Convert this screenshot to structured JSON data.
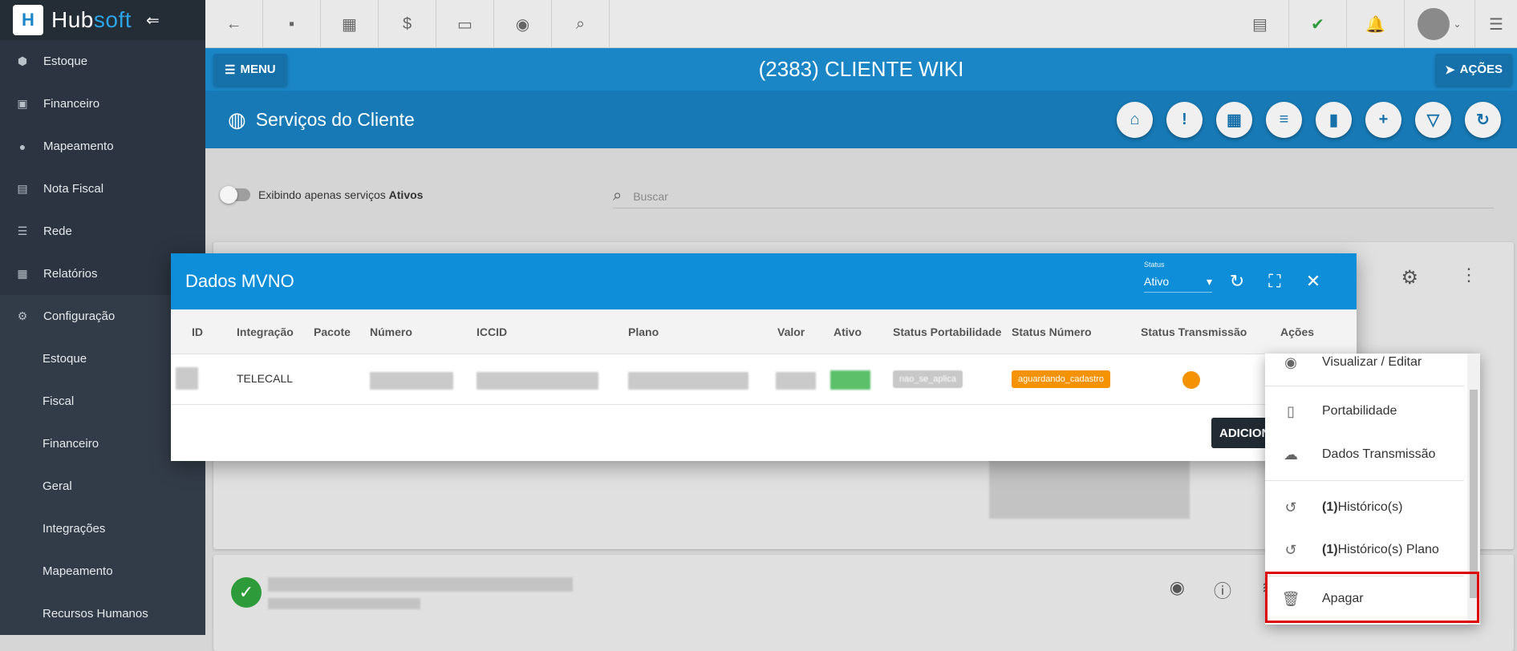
{
  "app": {
    "brand_left": "Hub",
    "brand_right": "soft"
  },
  "sidebar": {
    "items": [
      {
        "label": "Estoque",
        "icon": "cube-icon"
      },
      {
        "label": "Financeiro",
        "icon": "money-icon"
      },
      {
        "label": "Mapeamento",
        "icon": "map-pin-icon"
      },
      {
        "label": "Nota Fiscal",
        "icon": "document-icon"
      },
      {
        "label": "Rede",
        "icon": "server-icon"
      },
      {
        "label": "Relatórios",
        "icon": "report-icon"
      },
      {
        "label": "Configuração",
        "icon": "gear-icon"
      }
    ],
    "sub_items": [
      "Estoque",
      "Fiscal",
      "Financeiro",
      "Geral",
      "Integrações",
      "Mapeamento",
      "Recursos Humanos"
    ]
  },
  "header": {
    "menu_label": "MENU",
    "client_title": "(2383) CLIENTE WIKI",
    "actions_label": "AÇÕES"
  },
  "services": {
    "title": "Serviços do Cliente"
  },
  "filters": {
    "toggle_text": "Exibindo apenas serviços ",
    "toggle_bold": "Ativos",
    "search_placeholder": "Buscar"
  },
  "modal": {
    "title": "Dados MVNO",
    "status_label": "Status",
    "status_value": "Ativo",
    "columns": [
      "ID",
      "Integração",
      "Pacote",
      "Número",
      "ICCID",
      "Plano",
      "Valor",
      "Ativo",
      "Status Portabilidade",
      "Status Número",
      "Status Transmissão",
      "Ações"
    ],
    "row": {
      "integracao": "TELECALL",
      "status_portabilidade": "nao_se_aplica",
      "status_numero": "aguardando_cadastro"
    },
    "add_button": "ADICION"
  },
  "dropdown": {
    "items": [
      {
        "icon": "eye-icon",
        "label": "Visualizar / Editar"
      },
      {
        "icon": "phone-icon",
        "label": "Portabilidade"
      },
      {
        "icon": "cloud-upload-icon",
        "label": "Dados Transmissão"
      },
      {
        "icon": "history-icon",
        "count": "(1)",
        "label": " Histórico(s)"
      },
      {
        "icon": "history-icon",
        "count": "(1)",
        "label": " Histórico(s) Plano"
      },
      {
        "icon": "trash-icon",
        "label": "Apagar"
      }
    ]
  },
  "colors": {
    "primary": "#1b86c6",
    "sidebar": "#2b3440",
    "modal_header": "#0e8ed8",
    "warning": "#f59200",
    "highlight": "#e00000"
  }
}
